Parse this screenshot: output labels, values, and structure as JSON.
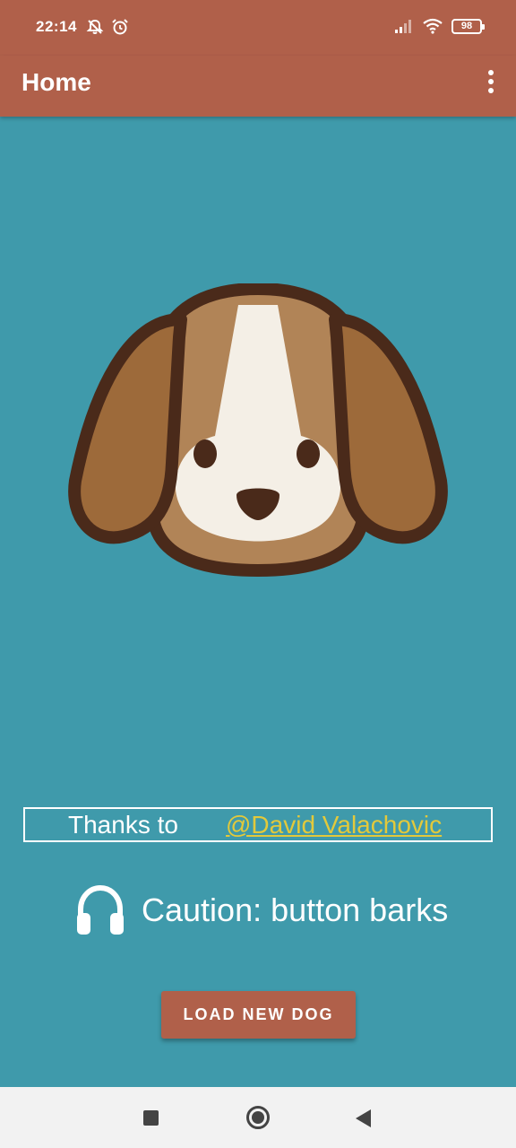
{
  "status_bar": {
    "time": "22:14",
    "battery": "98",
    "icons": [
      "notifications-off-icon",
      "alarm-icon",
      "signal-icon",
      "wifi-icon",
      "battery-icon"
    ]
  },
  "app_bar": {
    "title": "Home",
    "menu_icon": "overflow-menu-icon"
  },
  "main": {
    "image": "dog-face-illustration",
    "credits_label": "Thanks to",
    "credits_link": "@David Valachovic",
    "caution_icon": "headphones-icon",
    "caution_text": "Caution: button barks",
    "load_button_label": "LOAD NEW DOG"
  },
  "nav_bar": {
    "icons": [
      "recents-icon",
      "home-icon",
      "back-icon"
    ]
  },
  "colors": {
    "primary": "#b0604a",
    "background": "#3f9aab",
    "link": "#e2c93b"
  }
}
